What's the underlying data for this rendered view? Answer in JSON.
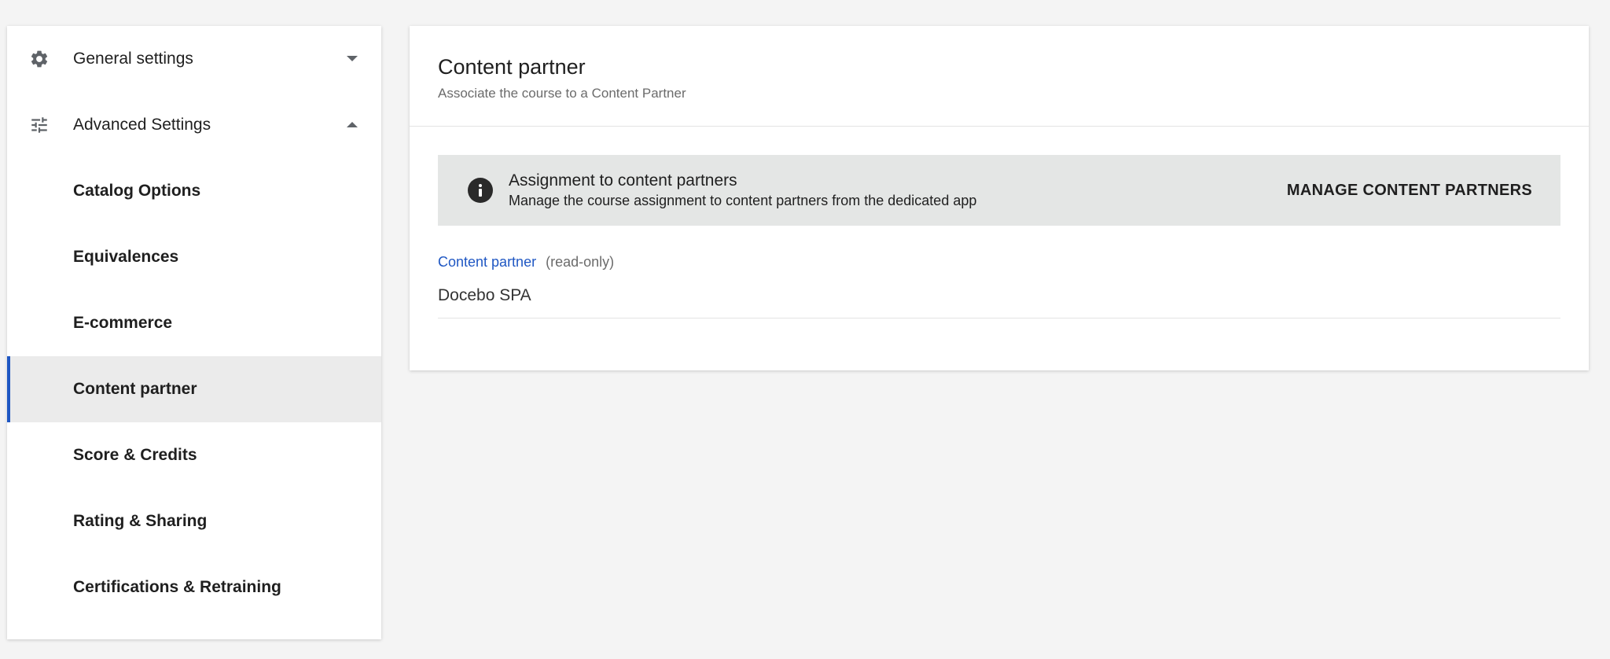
{
  "sidebar": {
    "sections": [
      {
        "label": "General settings",
        "icon": "gear-icon",
        "expanded": false
      },
      {
        "label": "Advanced Settings",
        "icon": "sliders-icon",
        "expanded": true
      }
    ],
    "items": [
      {
        "label": "Catalog Options"
      },
      {
        "label": "Equivalences"
      },
      {
        "label": "E-commerce"
      },
      {
        "label": "Content partner",
        "active": true
      },
      {
        "label": "Score & Credits"
      },
      {
        "label": "Rating & Sharing"
      },
      {
        "label": "Certifications & Retraining"
      }
    ]
  },
  "main": {
    "title": "Content partner",
    "subtitle": "Associate the course to a Content Partner",
    "banner": {
      "icon": "info-icon",
      "title": "Assignment to content partners",
      "description": "Manage the course assignment to content partners from the dedicated app",
      "action_label": "MANAGE CONTENT PARTNERS"
    },
    "field": {
      "label": "Content partner",
      "note": "(read-only)",
      "value": "Docebo SPA"
    }
  },
  "colors": {
    "accent": "#1f57c3",
    "active_background": "#ebebeb",
    "banner_background": "#e4e6e5",
    "page_background": "#f4f4f4"
  }
}
